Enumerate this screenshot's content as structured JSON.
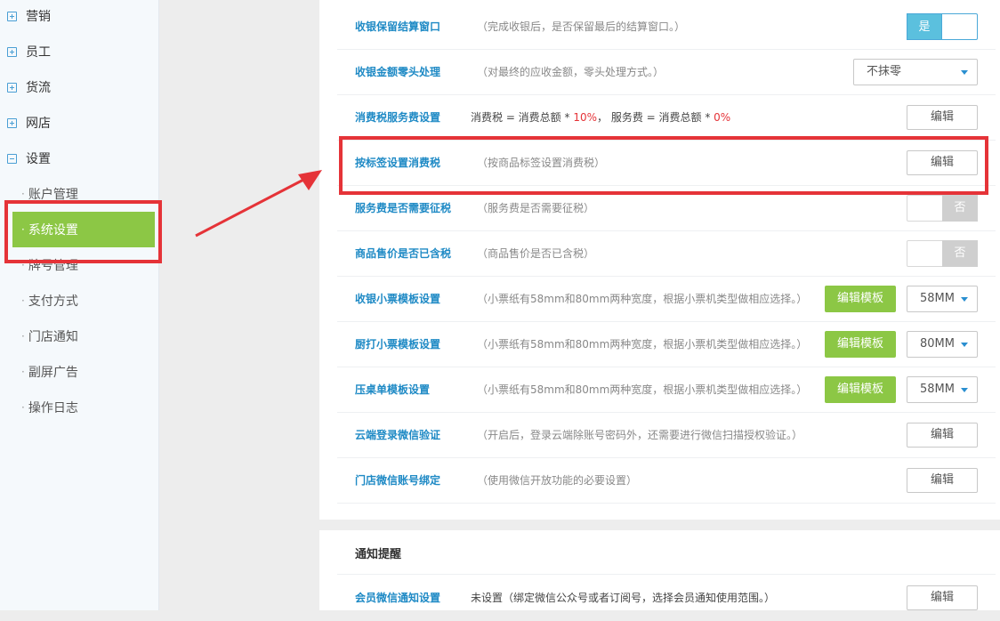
{
  "sidebar": {
    "top_items": [
      "营销",
      "员工",
      "货流",
      "网店",
      "设置"
    ],
    "sub_items": [
      "账户管理",
      "系统设置",
      "牌号管理",
      "支付方式",
      "门店通知",
      "副屏广告",
      "操作日志"
    ],
    "active_item": "系统设置"
  },
  "rows": [
    {
      "title": "收银保留结算窗口",
      "desc": "（完成收银后，是否保留最后的结算窗口。）",
      "control": "是"
    },
    {
      "title": "收银金额零头处理",
      "desc": "（对最终的应收金额，零头处理方式。）",
      "control": "不抹零"
    },
    {
      "title": "消费税服务费设置",
      "desc_parts": [
        "消费税 = 消费总额 * ",
        "10%",
        "， 服务费 = 消费总额 * ",
        "0%"
      ],
      "control": "编辑"
    },
    {
      "title": "按标签设置消费税",
      "desc": "（按商品标签设置消费税）",
      "control": "编辑"
    },
    {
      "title": "服务费是否需要征税",
      "desc": "（服务费是否需要征税）",
      "control": "否"
    },
    {
      "title": "商品售价是否已含税",
      "desc": "（商品售价是否已含税）",
      "control": "否"
    },
    {
      "title": "收银小票模板设置",
      "desc": "（小票纸有58mm和80mm两种宽度，根据小票机类型做相应选择。）",
      "button": "编辑模板",
      "control": "58MM"
    },
    {
      "title": "厨打小票模板设置",
      "desc": "（小票纸有58mm和80mm两种宽度，根据小票机类型做相应选择。）",
      "button": "编辑模板",
      "control": "80MM"
    },
    {
      "title": "压桌单模板设置",
      "desc": "（小票纸有58mm和80mm两种宽度，根据小票机类型做相应选择。）",
      "button": "编辑模板",
      "control": "58MM"
    },
    {
      "title": "云端登录微信验证",
      "desc": "（开启后，登录云端除账号密码外，还需要进行微信扫描授权验证。）",
      "control": "编辑"
    },
    {
      "title": "门店微信账号绑定",
      "desc": "（使用微信开放功能的必要设置）",
      "control": "编辑"
    }
  ],
  "notify_section": {
    "title": "通知提醒",
    "row": {
      "title": "会员微信通知设置",
      "desc": "未设置（绑定微信公众号或者订阅号，选择会员通知使用范围。）",
      "control": "编辑"
    }
  },
  "colors": {
    "accent_blue": "#1f8ac5",
    "green": "#8cc745",
    "highlight_red": "#e53338"
  }
}
